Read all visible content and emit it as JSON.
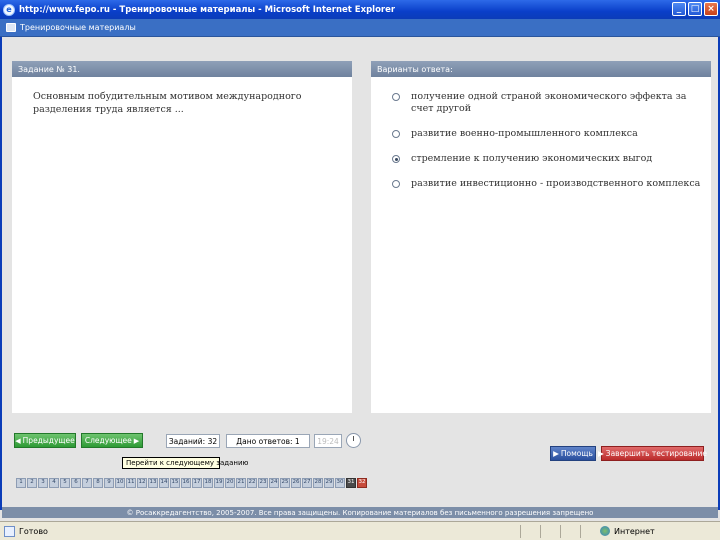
{
  "window": {
    "title": "http://www.fepo.ru - Тренировочные материалы - Microsoft Internet Explorer",
    "controls": [
      "_",
      "□",
      "×"
    ]
  },
  "pagebar": {
    "link": "Тренировочные материалы"
  },
  "question_panel": {
    "header": "Задание № 31.",
    "text": "Основным побудительным мотивом международного разделения труда является ..."
  },
  "answers_panel": {
    "header": "Варианты ответа:",
    "options": [
      {
        "text": "получение одной страной экономического эффекта за счет другой",
        "selected": false
      },
      {
        "text": "развитие военно-промышленного комплекса",
        "selected": false
      },
      {
        "text": "стремление к получению экономических выгод",
        "selected": true
      },
      {
        "text": "развитие инвестиционно - производственного комплекса",
        "selected": false
      }
    ]
  },
  "controls": {
    "prev": "Предыдущее",
    "next": "Следующее",
    "total_tasks": "Заданий: 32",
    "answered": "Дано ответов: 1",
    "time": "19:24",
    "tooltip": "Перейти к следующему заданию",
    "help": "Помощь",
    "finish": "Завершить тестирование"
  },
  "task_numbers": [
    "1",
    "2",
    "3",
    "4",
    "5",
    "6",
    "7",
    "8",
    "9",
    "10",
    "11",
    "12",
    "13",
    "14",
    "15",
    "16",
    "17",
    "18",
    "19",
    "20",
    "21",
    "22",
    "23",
    "24",
    "25",
    "26",
    "27",
    "28",
    "29",
    "30",
    "31",
    "32"
  ],
  "current_task": "31",
  "marked_task": "32",
  "footer": "© Росаккредагентство, 2005-2007. Все права защищены. Копирование материалов без письменного разрешения запрещено",
  "statusbar": {
    "text": "Готово",
    "zone": "Интернет"
  },
  "colors": {
    "titlebar": "#0a3fc9",
    "panel_header": "#7f91ab",
    "nav_green": "#2e9a35",
    "finish_red": "#bb2b2b",
    "help_blue": "#2a4f9e"
  }
}
